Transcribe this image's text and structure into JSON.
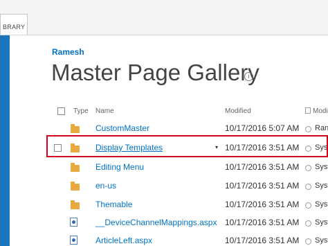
{
  "ribbon": {
    "tab_label": "BRARY"
  },
  "site": {
    "name": "Ramesh"
  },
  "page": {
    "title": "Master Page Gallery",
    "info_glyph": "i"
  },
  "columns": {
    "type": "Type",
    "name": "Name",
    "modified": "Modified",
    "modified_by": "Modi"
  },
  "rows": [
    {
      "icon": "folder-icon",
      "name": "CustomMaster",
      "modified": "10/17/2016 5:07 AM",
      "modified_by": "Ran"
    },
    {
      "icon": "folder-icon",
      "name": "Display Templates",
      "modified": "10/17/2016 3:51 AM",
      "modified_by": "Syst",
      "selected": true
    },
    {
      "icon": "folder-icon",
      "name": "Editing Menu",
      "modified": "10/17/2016 3:51 AM",
      "modified_by": "Syst"
    },
    {
      "icon": "folder-icon",
      "name": "en-us",
      "modified": "10/17/2016 3:51 AM",
      "modified_by": "Syst"
    },
    {
      "icon": "folder-icon",
      "name": "Themable",
      "modified": "10/17/2016 3:51 AM",
      "modified_by": "Syst"
    },
    {
      "icon": "aspx-file-icon",
      "name": "__DeviceChannelMappings.aspx",
      "modified": "10/17/2016 3:51 AM",
      "modified_by": "Syst"
    },
    {
      "icon": "aspx-file-icon",
      "name": "ArticleLeft.aspx",
      "modified": "10/17/2016 3:51 AM",
      "modified_by": "Syst"
    }
  ],
  "colors": {
    "accent": "#0072c6",
    "folder": "#e8a93f",
    "highlight": "#d0021b",
    "strip": "#1b75bb"
  }
}
